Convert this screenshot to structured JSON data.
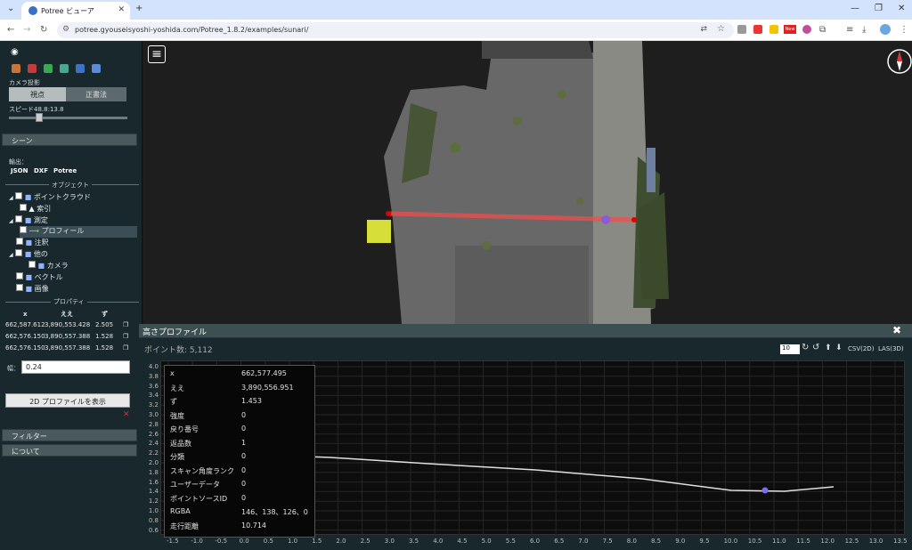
{
  "browser": {
    "tab_title": "Potree ビューア",
    "tab_close": "✕",
    "new_tab": "+",
    "url": "potree.gyouseisyoshi-yoshida.com/Potree_1.8.2/examples/sunari/",
    "win_min": "—",
    "win_max": "❐",
    "win_close": "✕",
    "ext_badge": "New"
  },
  "sidebar": {
    "camera_projection": "カメラ投影",
    "btn_perspective": "視点",
    "btn_orthographic": "正書法",
    "speed": "スピード48.8:13.8",
    "speed_fraction": 0.24,
    "scene_header": "シーン",
    "export_label": "輸出：",
    "export_json": "JSON",
    "export_dxf": "DXF",
    "export_potree": "Potree",
    "objects_header": "オブジェクト",
    "tree": [
      {
        "label": "ポイントクラウド",
        "level": 1
      },
      {
        "label": "索引",
        "level": 2
      },
      {
        "label": "測定",
        "level": 1
      },
      {
        "label": "プロフィール",
        "level": 2
      },
      {
        "label": "注釈",
        "level": 1
      },
      {
        "label": "他の",
        "level": 1
      },
      {
        "label": "カメラ",
        "level": 2
      },
      {
        "label": "ベクトル",
        "level": 1
      },
      {
        "label": "画像",
        "level": 1
      }
    ],
    "properties_header": "プロパティ",
    "col_x": "x",
    "col_y": "ええ",
    "col_z": "ず",
    "rows": [
      {
        "x": "662,587.612",
        "y": "3,890,553.428",
        "z": "2.505"
      },
      {
        "x": "662,576.150",
        "y": "3,890,557.388",
        "z": "1.528"
      },
      {
        "x": "662,576.150",
        "y": "3,890,557.388",
        "z": "1.528"
      }
    ],
    "width_label": "幅：",
    "width_value": "0.24",
    "show_2d": "2D プロファイルを表示",
    "delete_x": "✕",
    "filter": "フィルター",
    "about": "について"
  },
  "viewer": {
    "menu_icon": "≡"
  },
  "profile": {
    "title": "高さプロファイル",
    "point_count": "ポイント数:  5,112",
    "count_input": "10",
    "csv": "CSV(2D)",
    "las": "LAS(3D)",
    "close": "✖",
    "yticks": [
      "4.0",
      "3.8",
      "3.6",
      "3.4",
      "3.2",
      "3.0",
      "2.8",
      "2.6",
      "2.4",
      "2.2",
      "2.0",
      "1.8",
      "1.6",
      "1.4",
      "1.2",
      "1.0",
      "0.8",
      "0.6"
    ],
    "xticks": [
      "-1.5",
      "-1.0",
      "-0.5",
      "0.0",
      "0.5",
      "1.0",
      "1.5",
      "2.0",
      "2.5",
      "3.0",
      "3.5",
      "4.0",
      "4.5",
      "5.0",
      "5.5",
      "6.0",
      "6.5",
      "7.0",
      "7.5",
      "8.0",
      "8.5",
      "9.0",
      "9.5",
      "10.0",
      "10.5",
      "11.0",
      "11.5",
      "12.0",
      "12.5",
      "13.0",
      "13.5"
    ],
    "info": [
      {
        "k": "x",
        "v": "662,577.495"
      },
      {
        "k": "ええ",
        "v": "3,890,556.951"
      },
      {
        "k": "ず",
        "v": "1.453"
      },
      {
        "k": "強度",
        "v": "0"
      },
      {
        "k": "戻り番号",
        "v": "0"
      },
      {
        "k": "返品数",
        "v": "1"
      },
      {
        "k": "分類",
        "v": "0"
      },
      {
        "k": "スキャン角度ランク",
        "v": "0"
      },
      {
        "k": "ユーザーデータ",
        "v": "0"
      },
      {
        "k": "ポイントソースID",
        "v": "0"
      },
      {
        "k": "RGBA",
        "v": "146、138、126、0"
      },
      {
        "k": "走行距離",
        "v": "10.714"
      }
    ]
  }
}
